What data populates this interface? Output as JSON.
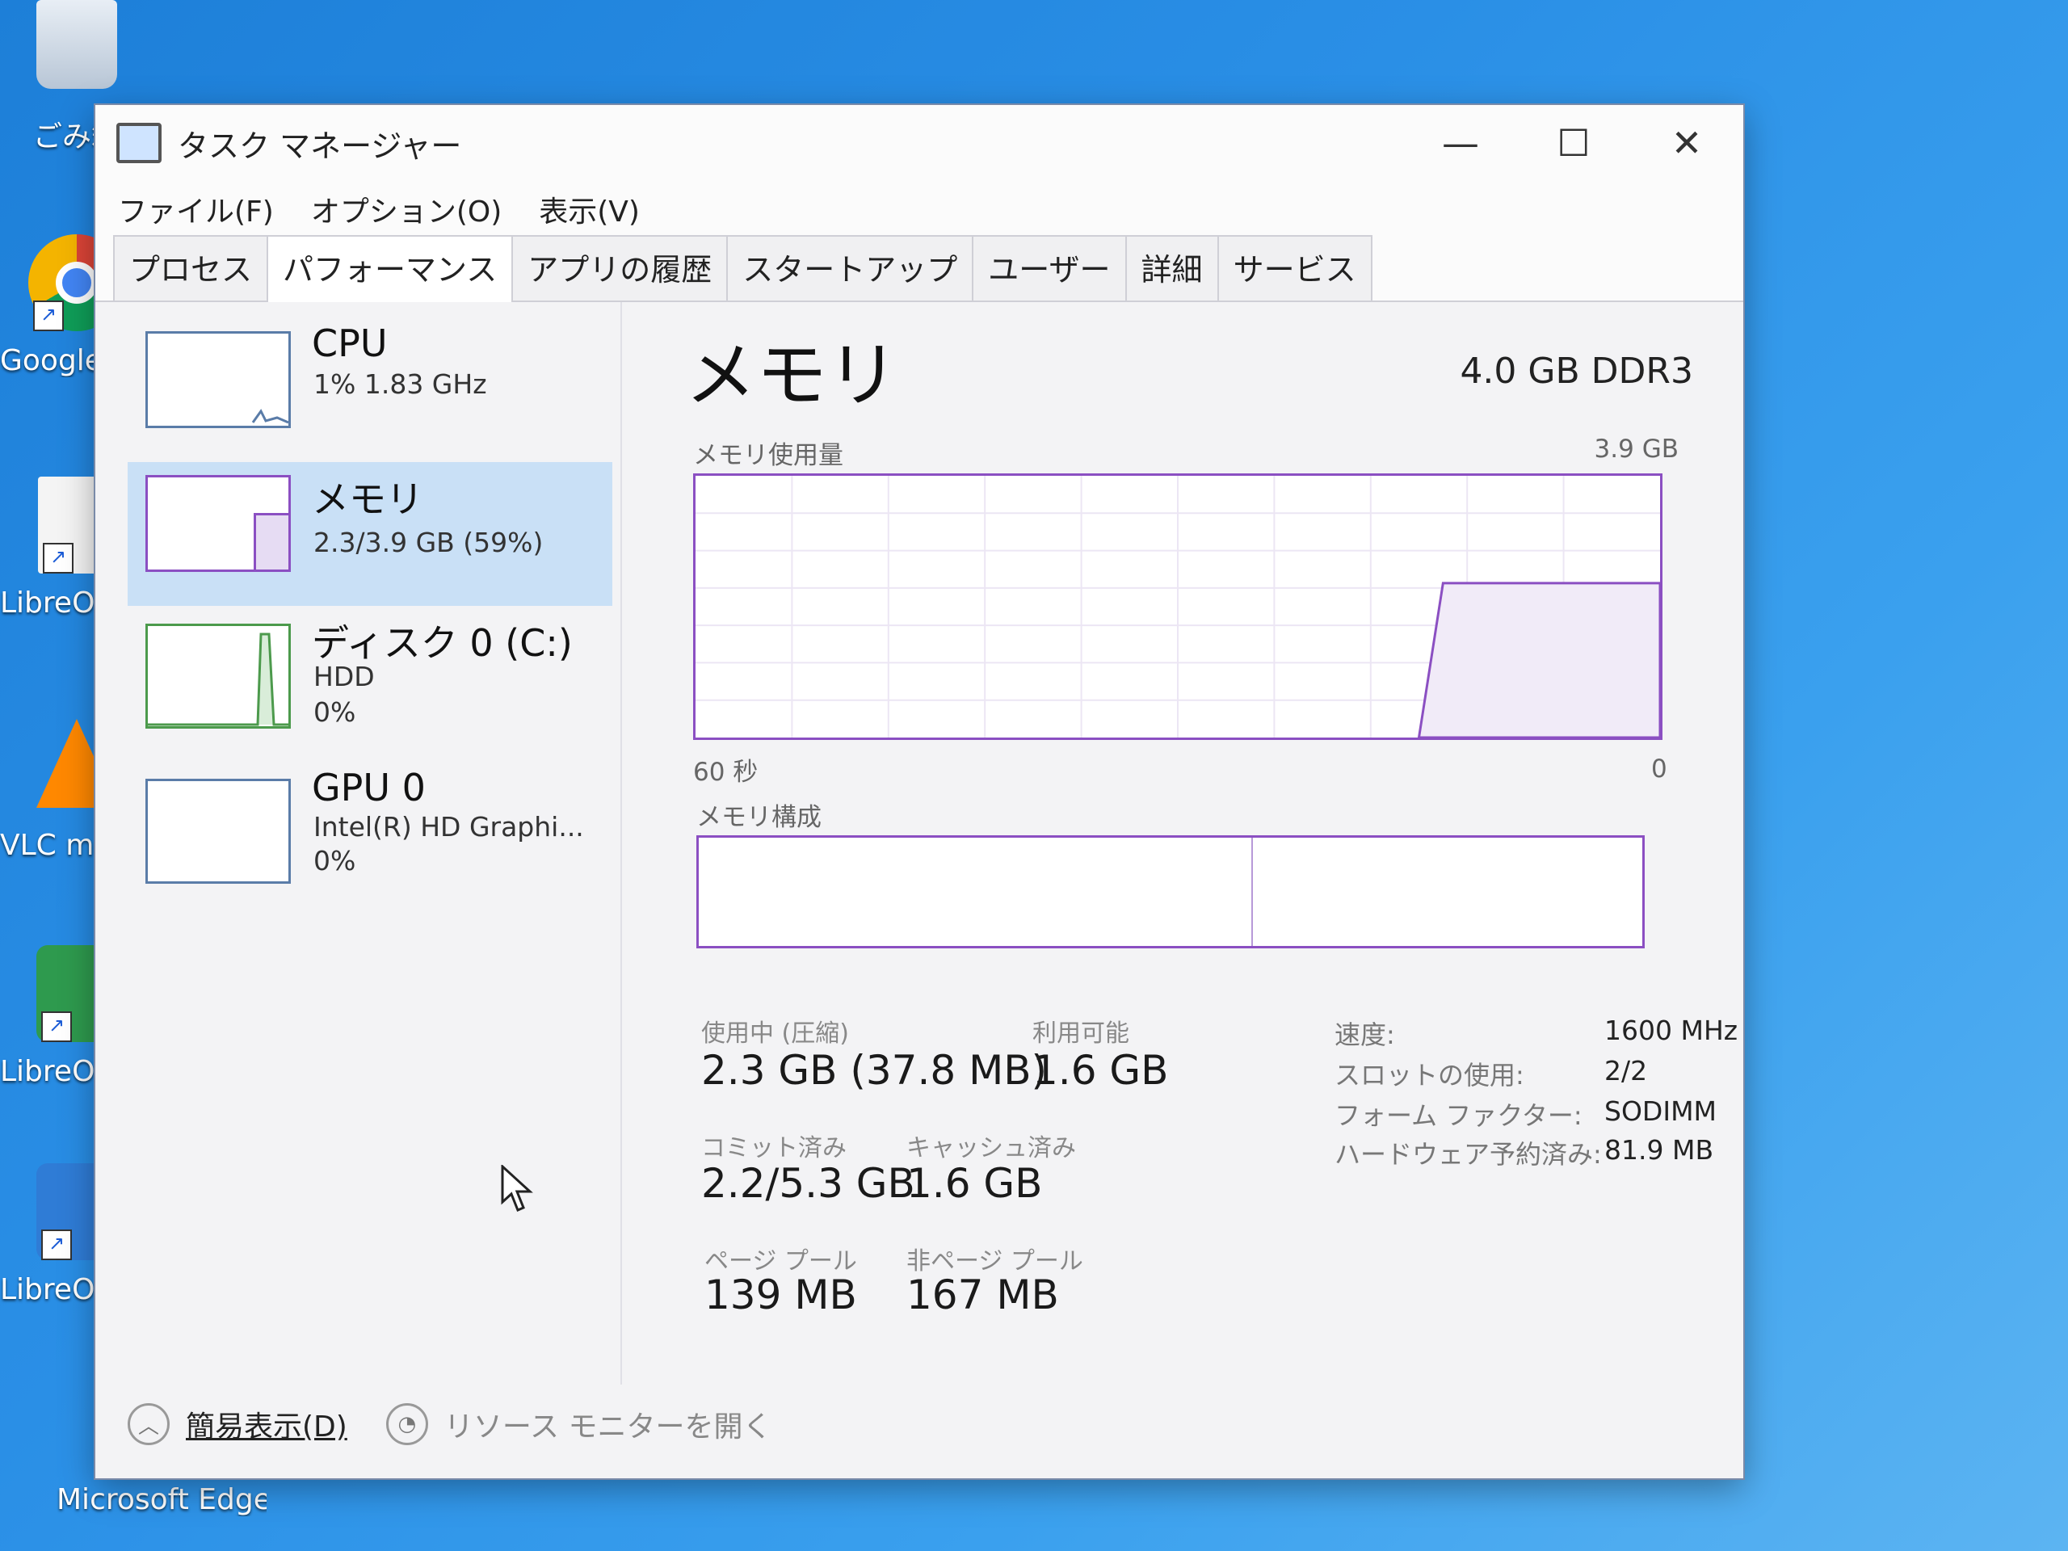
{
  "desktop": {
    "icons": [
      {
        "label": "ごみ箱",
        "icon": "recycle-bin-icon"
      },
      {
        "label": "Google Chrome",
        "icon": "chrome-icon"
      },
      {
        "label": "LibreOffice",
        "icon": "document-icon"
      },
      {
        "label": "VLC media player",
        "icon": "vlc-cone-icon"
      },
      {
        "label": "LibreOffice Calc",
        "icon": "spreadsheet-icon"
      },
      {
        "label": "LibreOffice Writer",
        "icon": "writer-icon"
      },
      {
        "label": "Microsoft Edge",
        "icon": "edge-icon"
      }
    ]
  },
  "window": {
    "title": "タスク マネージャー",
    "controls": {
      "minimize": "—",
      "maximize": "☐",
      "close": "✕"
    }
  },
  "menu": {
    "file": "ファイル(F)",
    "options": "オプション(O)",
    "view": "表示(V)"
  },
  "tabs": [
    "プロセス",
    "パフォーマンス",
    "アプリの履歴",
    "スタートアップ",
    "ユーザー",
    "詳細",
    "サービス"
  ],
  "active_tab": "パフォーマンス",
  "sidebar": {
    "cpu": {
      "name": "CPU",
      "sub": "1%  1.83 GHz"
    },
    "memory": {
      "name": "メモリ",
      "sub": "2.3/3.9 GB (59%)"
    },
    "disk": {
      "name": "ディスク 0 (C:)",
      "sub1": "HDD",
      "sub2": "0%"
    },
    "gpu": {
      "name": "GPU 0",
      "sub1": "Intel(R) HD Graphi...",
      "sub2": "0%"
    }
  },
  "memory_panel": {
    "title": "メモリ",
    "spec": "4.0 GB DDR3",
    "usage_label": "メモリ使用量",
    "usage_max": "3.9 GB",
    "axis_left": "60 秒",
    "axis_right": "0",
    "composition_label": "メモリ構成",
    "stats": {
      "in_use_label": "使用中 (圧縮)",
      "in_use_value": "2.3 GB (37.8 MB)",
      "available_label": "利用可能",
      "available_value": "1.6 GB",
      "committed_label": "コミット済み",
      "committed_value": "2.2/5.3 GB",
      "cached_label": "キャッシュ済み",
      "cached_value": "1.6 GB",
      "paged_label": "ページ プール",
      "paged_value": "139 MB",
      "nonpaged_label": "非ページ プール",
      "nonpaged_value": "167 MB"
    },
    "specs": {
      "speed_label": "速度:",
      "speed_value": "1600 MHz",
      "slots_label": "スロットの使用:",
      "slots_value": "2/2",
      "form_label": "フォーム ファクター:",
      "form_value": "SODIMM",
      "reserved_label": "ハードウェア予約済み:",
      "reserved_value": "81.9 MB"
    },
    "usage_fraction": 0.59
  },
  "footer": {
    "fewer_details": "簡易表示(D)",
    "resource_monitor": "リソース モニターを開く"
  },
  "colors": {
    "accent": "#8b4fc2",
    "selected": "#c9e0f6",
    "thumb_border": "#5a7ca8"
  }
}
